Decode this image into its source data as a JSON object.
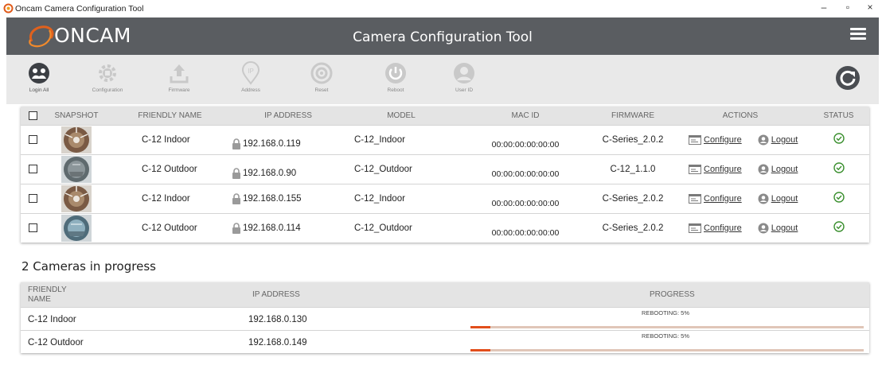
{
  "window": {
    "title": "Oncam Camera Configuration Tool",
    "minimize": "–",
    "restore": "▫",
    "close": "×"
  },
  "header": {
    "brand": "ONCAM",
    "title": "Camera Configuration Tool",
    "bg_color": "#5a5d61"
  },
  "toolbar": {
    "items": [
      {
        "label": "Login All",
        "icon": "login-all-icon",
        "enabled": true
      },
      {
        "label": "Configuration",
        "icon": "configuration-icon",
        "enabled": false
      },
      {
        "label": "Firmware",
        "icon": "firmware-upload-icon",
        "enabled": false
      },
      {
        "label": "Address",
        "icon": "ip-address-icon",
        "enabled": false
      },
      {
        "label": "Reset",
        "icon": "reset-icon",
        "enabled": false
      },
      {
        "label": "Reboot",
        "icon": "power-icon",
        "enabled": false
      },
      {
        "label": "User ID",
        "icon": "user-icon",
        "enabled": false
      }
    ],
    "refresh_icon": "refresh-icon"
  },
  "cameras": {
    "columns": [
      "SNAPSHOT",
      "FRIENDLY NAME",
      "IP ADDRESS",
      "MODEL",
      "MAC ID",
      "FIRMWARE",
      "ACTIONS",
      "STATUS"
    ],
    "rows": [
      {
        "friendly_name": "C-12 Indoor",
        "ip": "192.168.0.119",
        "model": "C-12_Indoor",
        "mac": "00:00:00:00:00:00",
        "firmware": "C-Series_2.0.2",
        "configure": "Configure",
        "logout": "Logout"
      },
      {
        "friendly_name": "C-12 Outdoor",
        "ip": "192.168.0.90",
        "model": "C-12_Outdoor",
        "mac": "00:00:00:00:00:00",
        "firmware": "C-12_1.1.0",
        "configure": "Configure",
        "logout": "Logout"
      },
      {
        "friendly_name": "C-12 Indoor",
        "ip": "192.168.0.155",
        "model": "C-12_Indoor",
        "mac": "00:00:00:00:00:00",
        "firmware": "C-Series_2.0.2",
        "configure": "Configure",
        "logout": "Logout"
      },
      {
        "friendly_name": "C-12 Outdoor",
        "ip": "192.168.0.114",
        "model": "C-12_Outdoor",
        "mac": "00:00:00:00:00:00",
        "firmware": "C-Series_2.0.2",
        "configure": "Configure",
        "logout": "Logout"
      }
    ]
  },
  "progress": {
    "heading": "2 Cameras in progress",
    "columns": {
      "friendly_name": "FRIENDLY NAME",
      "ip": "IP ADDRESS",
      "progress": "PROGRESS"
    },
    "rows": [
      {
        "friendly_name": "C-12 Indoor",
        "ip": "192.168.0.130",
        "status": "REBOOTING: 5%",
        "percent": 5
      },
      {
        "friendly_name": "C-12 Outdoor",
        "ip": "192.168.0.149",
        "status": "REBOOTING: 5%",
        "percent": 5
      }
    ],
    "bar_color": "#e24e1b",
    "track_color": "#e0c6b8"
  },
  "colors": {
    "status_ok": "#3a8f2e",
    "toolbar_bg": "#e9e9e9"
  }
}
